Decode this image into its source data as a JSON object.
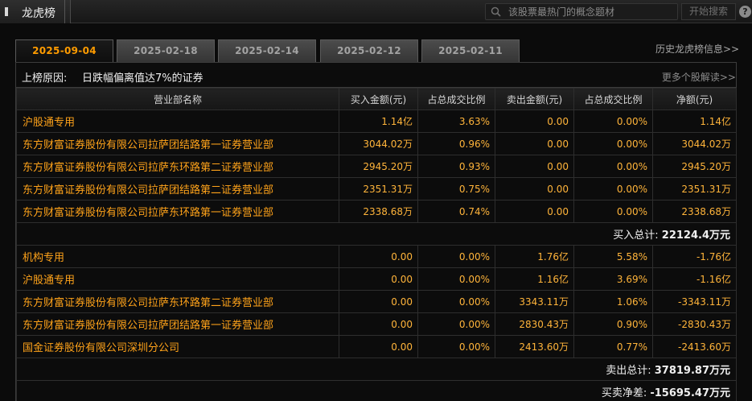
{
  "header": {
    "title": "龙虎榜",
    "search_placeholder": "该股票最热门的概念题材",
    "search_button": "开始搜索",
    "help": "?"
  },
  "tabs": [
    {
      "label": "2025-09-04",
      "active": true
    },
    {
      "label": "2025-02-18",
      "active": false
    },
    {
      "label": "2025-02-14",
      "active": false
    },
    {
      "label": "2025-02-12",
      "active": false
    },
    {
      "label": "2025-02-11",
      "active": false
    }
  ],
  "history_link": "历史龙虎榜信息>>",
  "reason": {
    "label": "上榜原因:",
    "value": "日跌幅偏离值达7%的证券",
    "more": "更多个股解读>>"
  },
  "table": {
    "headers": [
      "营业部名称",
      "买入金额(元)",
      "占总成交比例",
      "卖出金额(元)",
      "占总成交比例",
      "净额(元)"
    ],
    "buy_rows": [
      [
        "沪股通专用",
        "1.14亿",
        "3.63%",
        "0.00",
        "0.00%",
        "1.14亿"
      ],
      [
        "东方财富证券股份有限公司拉萨团结路第一证券营业部",
        "3044.02万",
        "0.96%",
        "0.00",
        "0.00%",
        "3044.02万"
      ],
      [
        "东方财富证券股份有限公司拉萨东环路第二证券营业部",
        "2945.20万",
        "0.93%",
        "0.00",
        "0.00%",
        "2945.20万"
      ],
      [
        "东方财富证券股份有限公司拉萨团结路第二证券营业部",
        "2351.31万",
        "0.75%",
        "0.00",
        "0.00%",
        "2351.31万"
      ],
      [
        "东方财富证券股份有限公司拉萨东环路第一证券营业部",
        "2338.68万",
        "0.74%",
        "0.00",
        "0.00%",
        "2338.68万"
      ]
    ],
    "buy_total_label": "买入总计:",
    "buy_total_value": "22124.4万元",
    "sell_rows": [
      [
        "机构专用",
        "0.00",
        "0.00%",
        "1.76亿",
        "5.58%",
        "-1.76亿"
      ],
      [
        "沪股通专用",
        "0.00",
        "0.00%",
        "1.16亿",
        "3.69%",
        "-1.16亿"
      ],
      [
        "东方财富证券股份有限公司拉萨东环路第二证券营业部",
        "0.00",
        "0.00%",
        "3343.11万",
        "1.06%",
        "-3343.11万"
      ],
      [
        "东方财富证券股份有限公司拉萨团结路第一证券营业部",
        "0.00",
        "0.00%",
        "2830.43万",
        "0.90%",
        "-2830.43万"
      ],
      [
        "国金证券股份有限公司深圳分公司",
        "0.00",
        "0.00%",
        "2413.60万",
        "0.77%",
        "-2413.60万"
      ]
    ],
    "sell_total_label": "卖出总计:",
    "sell_total_value": "37819.87万元",
    "net_label": "买卖净差:",
    "net_value": "-15695.47万元"
  }
}
